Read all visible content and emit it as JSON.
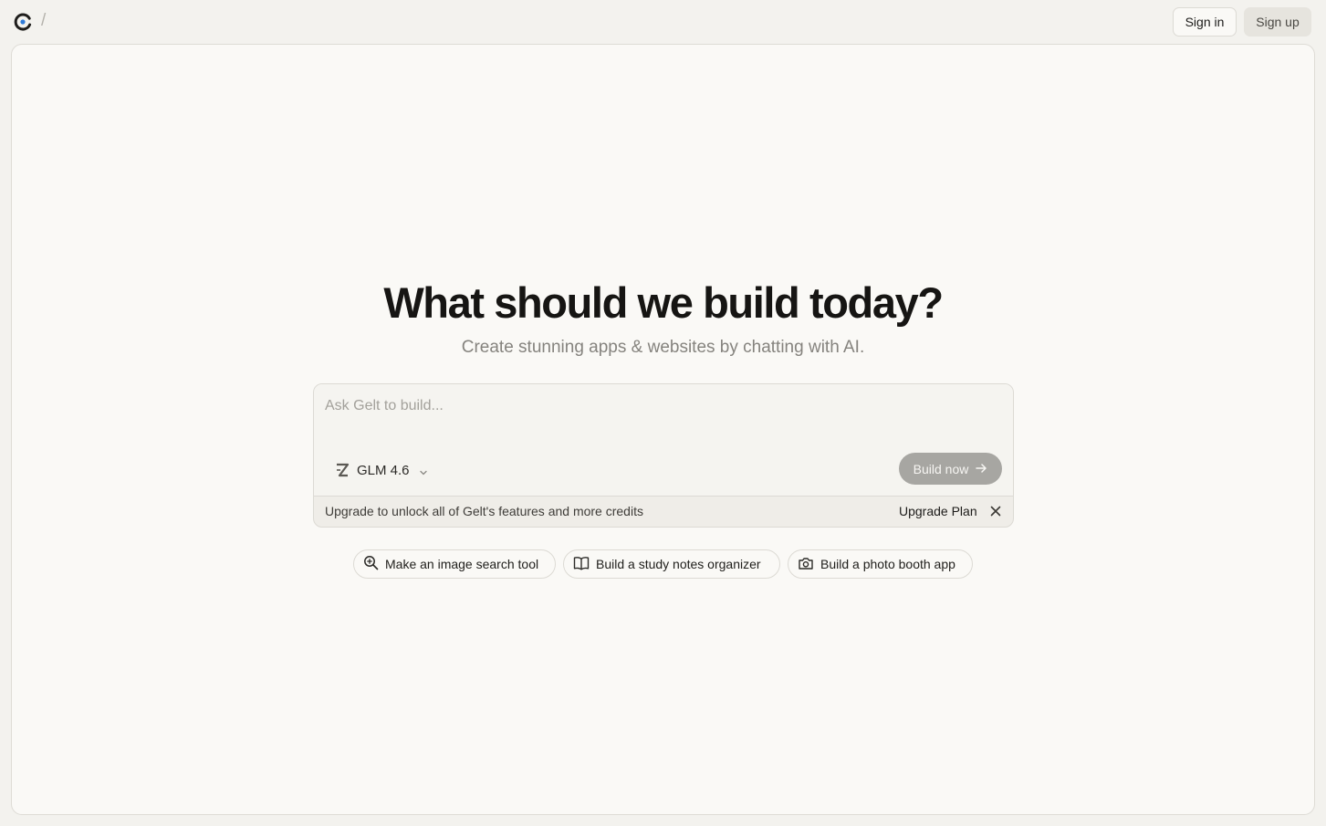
{
  "header": {
    "logo": "gelt-logo-icon",
    "breadcrumb_separator": "/",
    "sign_in_label": "Sign in",
    "sign_up_label": "Sign up"
  },
  "hero": {
    "title": "What should we build today?",
    "subtitle": "Create stunning apps & websites by chatting with AI."
  },
  "composer": {
    "value": "",
    "placeholder": "Ask Gelt to build...",
    "model_icon": "zhipu-z-icon",
    "model_label": "GLM 4.6",
    "build_label": "Build now",
    "upgrade_text": "Upgrade to unlock all of Gelt's features and more credits",
    "upgrade_link": "Upgrade Plan"
  },
  "suggestions": [
    {
      "icon": "zoom-search-icon",
      "label": "Make an image search tool"
    },
    {
      "icon": "open-book-icon",
      "label": "Build a study notes organizer"
    },
    {
      "icon": "camera-icon",
      "label": "Build a photo booth app"
    }
  ],
  "colors": {
    "page_background": "#f3f2ee",
    "panel_background": "#faf9f6",
    "build_button": "#a7a6a2",
    "logo_blue": "#2f7bd8"
  }
}
